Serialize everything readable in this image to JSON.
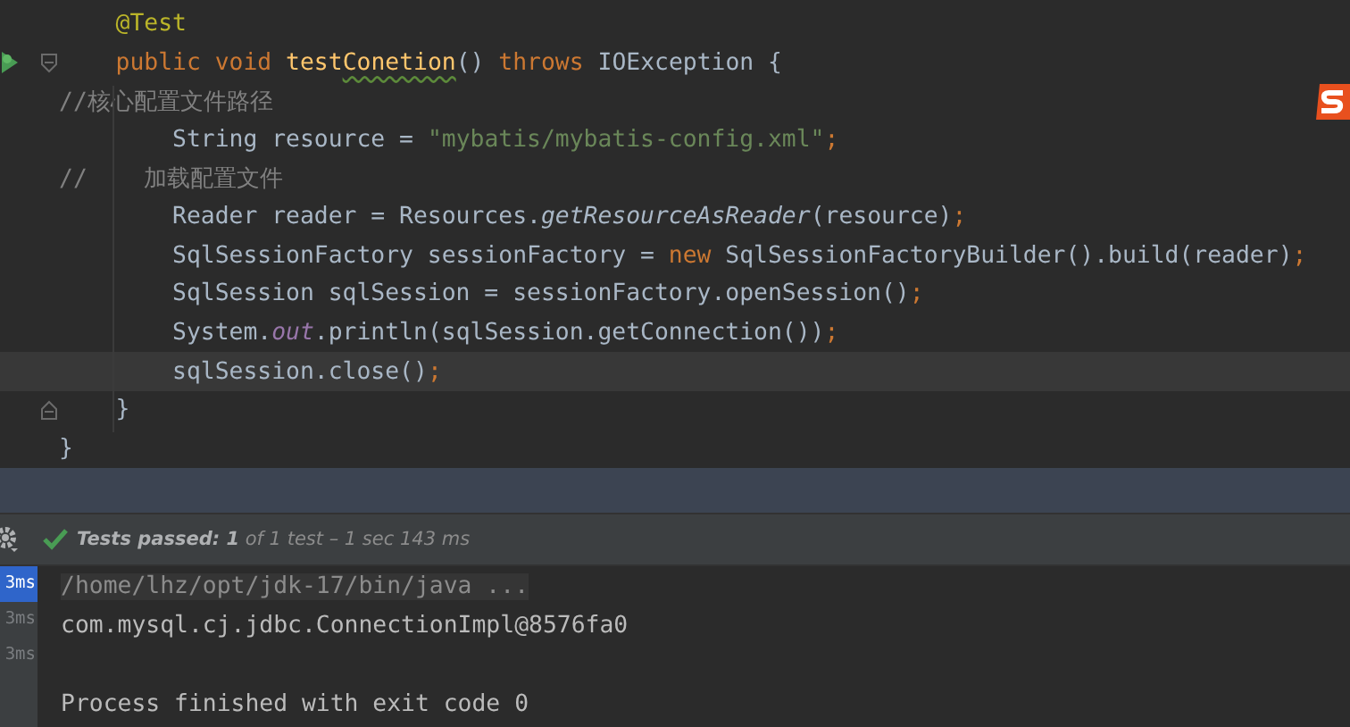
{
  "editor": {
    "lines": [
      {
        "current": false,
        "run_icon": false,
        "fold_start": false,
        "fold_end": false,
        "tokens": [
          {
            "kind": "ann",
            "text": "    @Test"
          }
        ]
      },
      {
        "current": false,
        "run_icon": true,
        "fold_start": true,
        "fold_end": false,
        "tokens": [
          {
            "kind": "kw",
            "text": "    public void "
          },
          {
            "kind": "decl",
            "text": "test"
          },
          {
            "kind": "decl_typo",
            "text": "Conetion"
          },
          {
            "kind": "plain",
            "text": "() "
          },
          {
            "kind": "kw",
            "text": "throws "
          },
          {
            "kind": "plain",
            "text": "IOException {"
          }
        ]
      },
      {
        "current": false,
        "run_icon": false,
        "fold_start": false,
        "fold_end": false,
        "tokens": [
          {
            "kind": "cmt",
            "text": "//核心配置文件路径"
          }
        ]
      },
      {
        "current": false,
        "run_icon": false,
        "fold_start": false,
        "fold_end": false,
        "tokens": [
          {
            "kind": "plain",
            "text": "        String resource = "
          },
          {
            "kind": "str",
            "text": "\"mybatis/mybatis-config.xml\""
          },
          {
            "kind": "punct",
            "text": ";"
          }
        ]
      },
      {
        "current": false,
        "run_icon": false,
        "fold_start": false,
        "fold_end": false,
        "tokens": [
          {
            "kind": "cmt",
            "text": "//    加载配置文件"
          }
        ]
      },
      {
        "current": false,
        "run_icon": false,
        "fold_start": false,
        "fold_end": false,
        "tokens": [
          {
            "kind": "plain",
            "text": "        Reader reader = Resources."
          },
          {
            "kind": "static",
            "text": "getResourceAsReader"
          },
          {
            "kind": "plain",
            "text": "(resource)"
          },
          {
            "kind": "punct",
            "text": ";"
          }
        ]
      },
      {
        "current": false,
        "run_icon": false,
        "fold_start": false,
        "fold_end": false,
        "tokens": [
          {
            "kind": "plain",
            "text": "        SqlSessionFactory sessionFactory = "
          },
          {
            "kind": "kw",
            "text": "new "
          },
          {
            "kind": "plain",
            "text": "SqlSessionFactoryBuilder().build(reader)"
          },
          {
            "kind": "punct",
            "text": ";"
          }
        ]
      },
      {
        "current": false,
        "run_icon": false,
        "fold_start": false,
        "fold_end": false,
        "tokens": [
          {
            "kind": "plain",
            "text": "        SqlSession sqlSession = sessionFactory.openSession()"
          },
          {
            "kind": "punct",
            "text": ";"
          }
        ]
      },
      {
        "current": false,
        "run_icon": false,
        "fold_start": false,
        "fold_end": false,
        "tokens": [
          {
            "kind": "plain",
            "text": "        System."
          },
          {
            "kind": "field",
            "text": "out"
          },
          {
            "kind": "plain",
            "text": ".println(sqlSession.getConnection())"
          },
          {
            "kind": "punct",
            "text": ";"
          }
        ]
      },
      {
        "current": true,
        "run_icon": false,
        "fold_start": false,
        "fold_end": false,
        "tokens": [
          {
            "kind": "plain",
            "text": "        sqlSession.close()"
          },
          {
            "kind": "punct",
            "text": ";"
          }
        ]
      },
      {
        "current": false,
        "run_icon": false,
        "fold_start": false,
        "fold_end": true,
        "tokens": [
          {
            "kind": "plain",
            "text": "    }"
          }
        ]
      },
      {
        "current": false,
        "run_icon": false,
        "fold_start": false,
        "fold_end": false,
        "tokens": [
          {
            "kind": "plain",
            "text": "}"
          }
        ]
      }
    ]
  },
  "test_bar": {
    "status": "Tests passed:",
    "passed": "1",
    "rest": "of 1 test – 1 sec 143 ms"
  },
  "test_list": [
    {
      "time": "3ms",
      "selected": true
    },
    {
      "time": "3ms",
      "selected": false
    },
    {
      "time": "3ms",
      "selected": false
    }
  ],
  "console": [
    {
      "kind": "command",
      "text": "/home/lhz/opt/jdk-17/bin/java ..."
    },
    {
      "kind": "output",
      "text": "com.mysql.cj.jdbc.ConnectionImpl@8576fa0"
    },
    {
      "kind": "blank"
    },
    {
      "kind": "output",
      "text": "Process finished with exit code 0"
    }
  ]
}
